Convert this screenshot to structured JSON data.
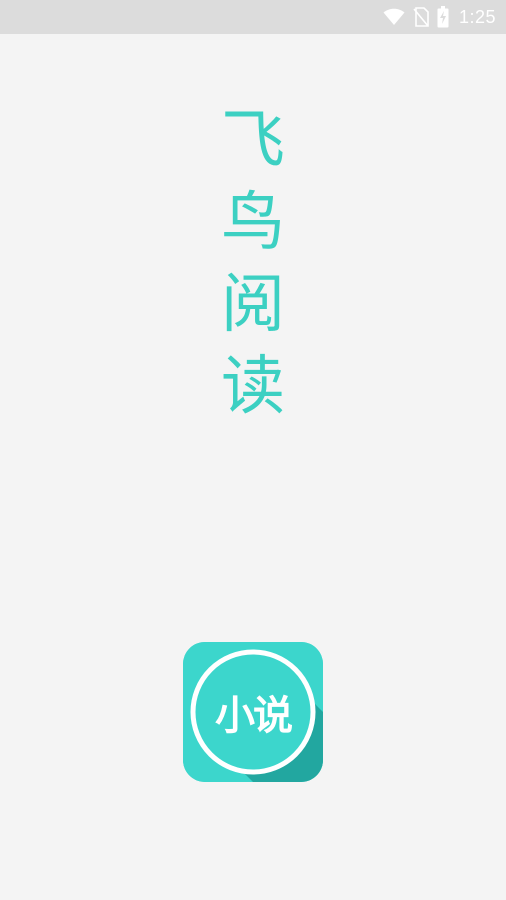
{
  "status_bar": {
    "time": "1:25",
    "icons": [
      "wifi-icon",
      "no-sim-icon",
      "battery-charging-icon"
    ]
  },
  "splash": {
    "title_chars": [
      "飞",
      "鸟",
      "阅",
      "读"
    ]
  },
  "app_logo": {
    "text": "小说",
    "colors": {
      "background": "#3cd6cc",
      "shadow": "#22a7a0",
      "ring": "#ffffff"
    }
  },
  "colors": {
    "accent": "#3cd0c2",
    "page_background": "#f4f4f4",
    "status_bar": "#dcdcdc"
  }
}
